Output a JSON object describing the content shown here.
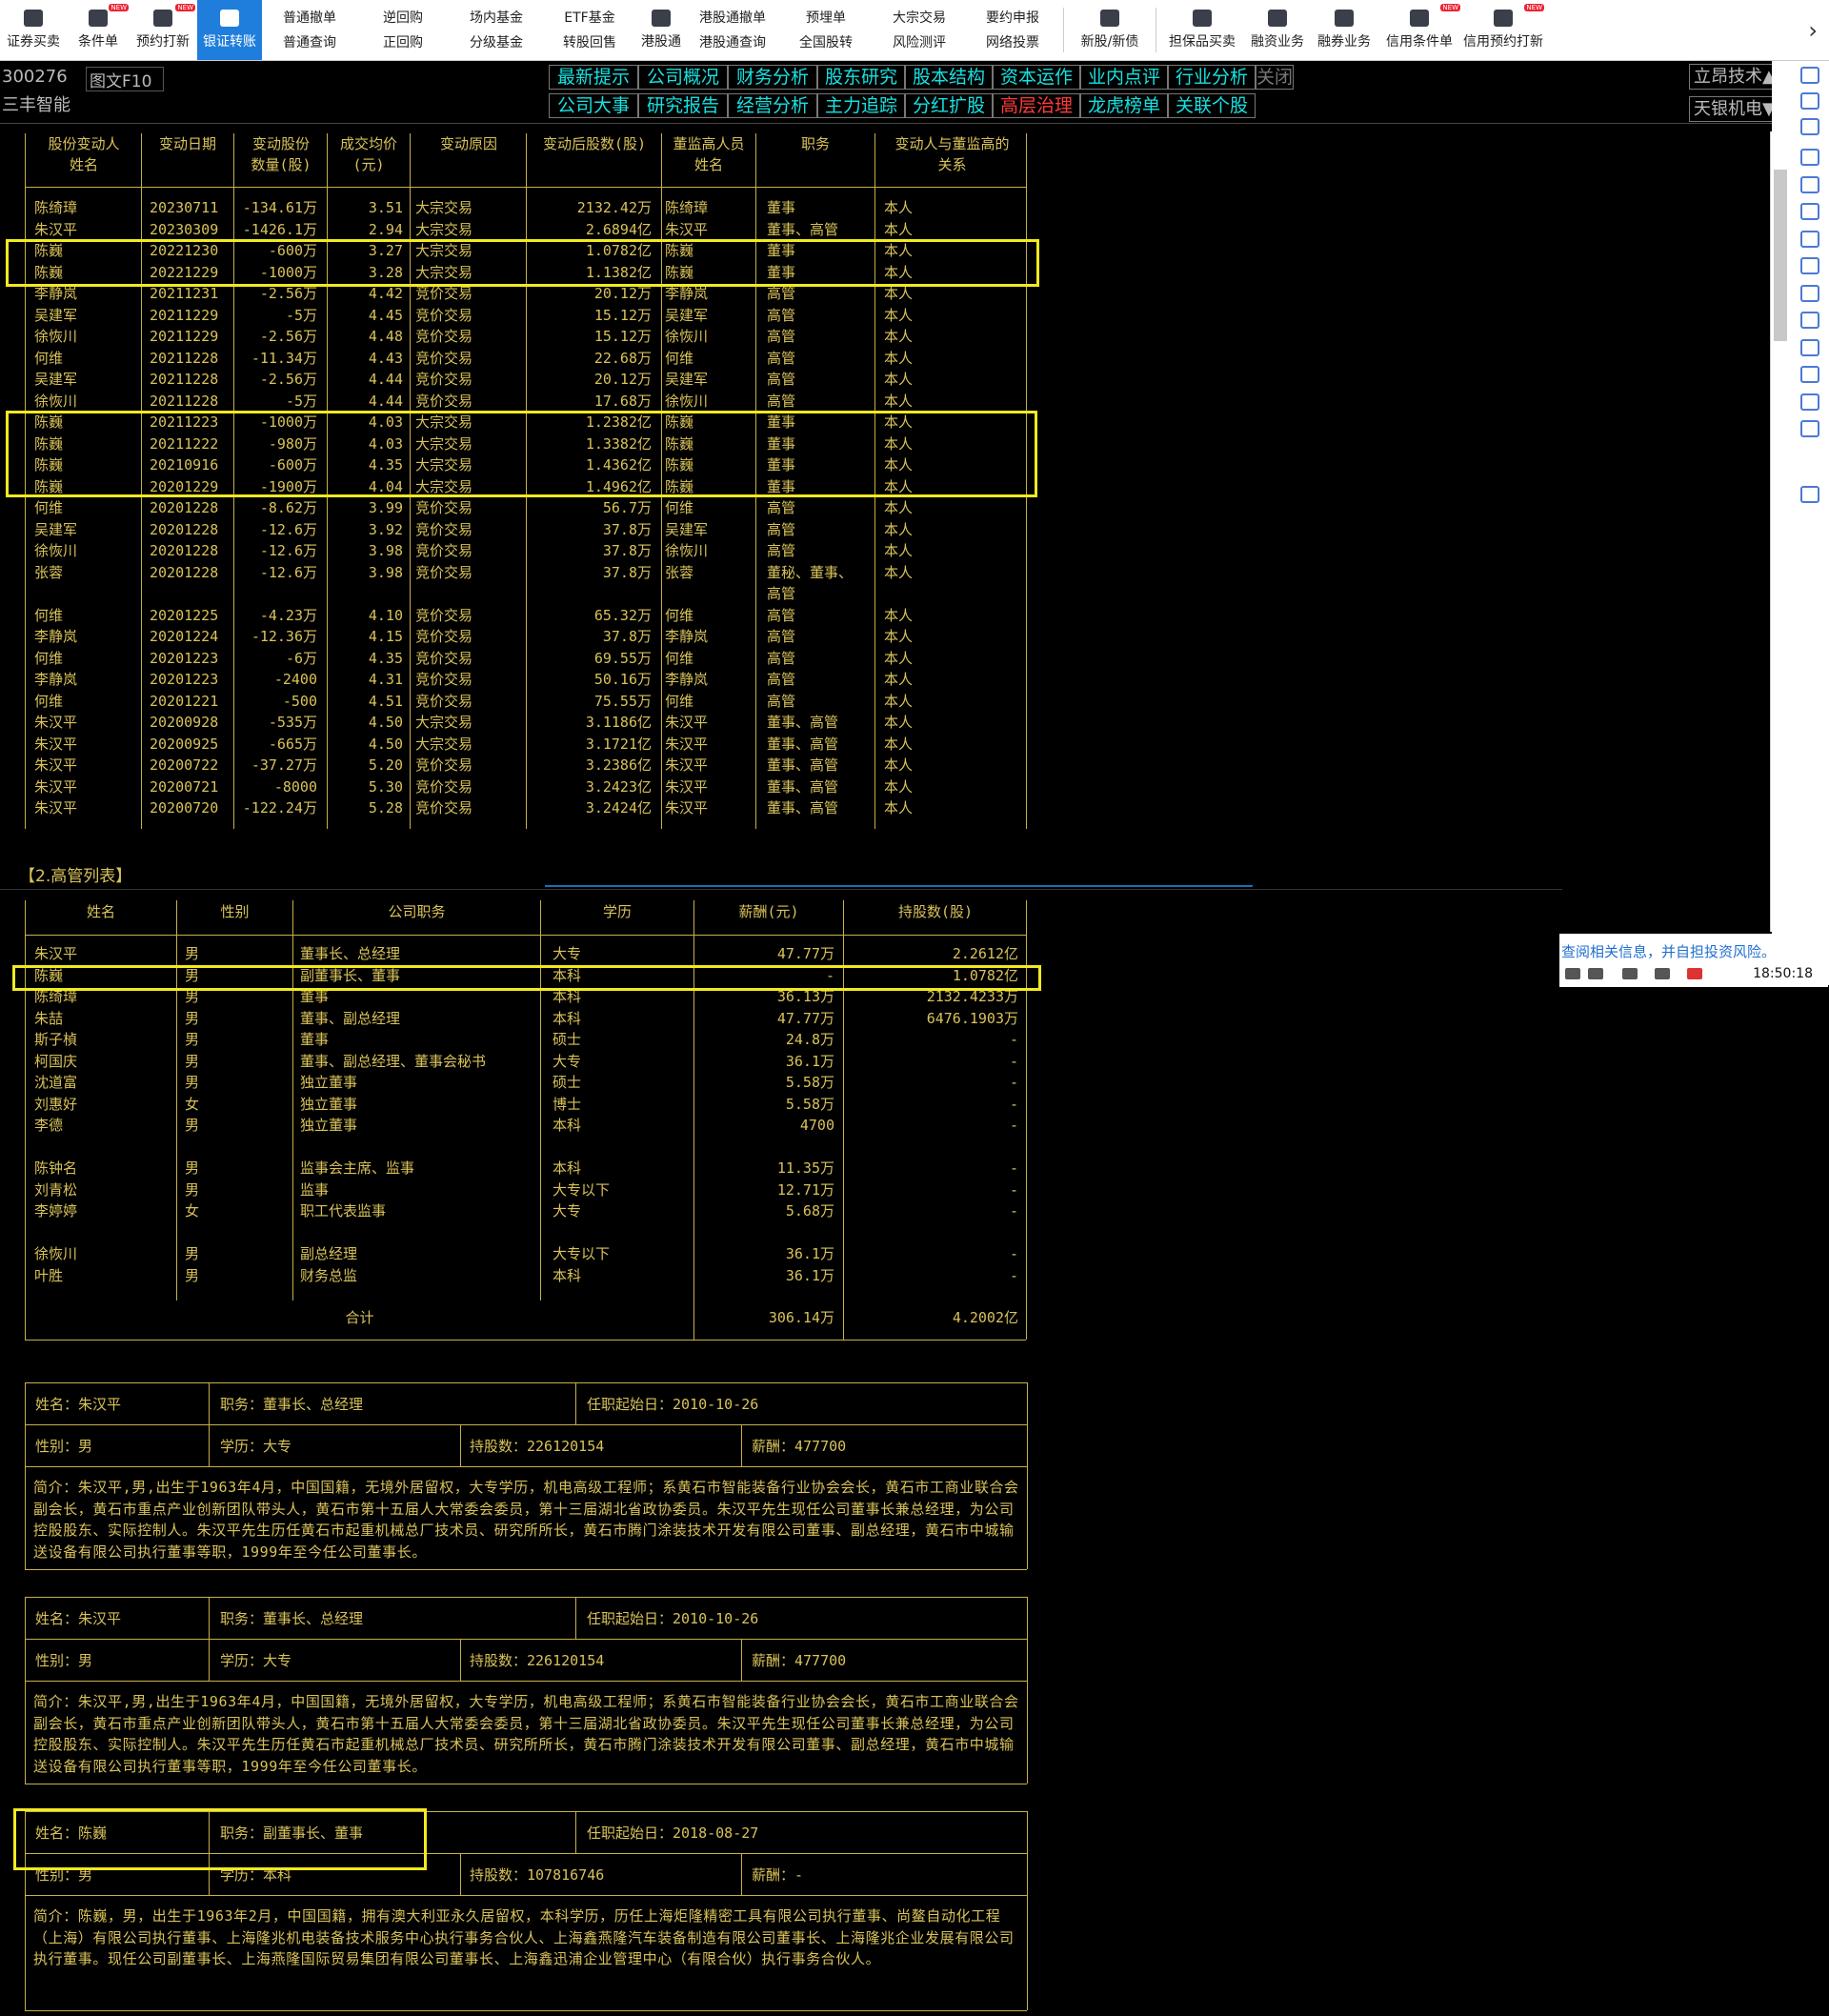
{
  "toolbar": {
    "items": [
      {
        "label": "证券买卖",
        "icon": "chart-icon",
        "new": false
      },
      {
        "label": "条件单",
        "icon": "document-icon",
        "new": true
      },
      {
        "label": "预约打新",
        "icon": "calendar-icon",
        "new": true
      },
      {
        "label": "银证转账",
        "icon": "transfer-icon",
        "new": false,
        "active": true
      }
    ],
    "doubles": [
      {
        "top": "普通撤单",
        "bottom": "普通查询"
      },
      {
        "top": "逆回购",
        "bottom": "正回购"
      },
      {
        "top": "场内基金",
        "bottom": "分级基金"
      },
      {
        "top": "ETF基金",
        "bottom": "转股回售"
      }
    ],
    "hk": {
      "label": "港股通",
      "icon": "hk-icon"
    },
    "doubles2": [
      {
        "top": "港股通撤单",
        "bottom": "港股通查询"
      },
      {
        "top": "预埋单",
        "bottom": "全国股转"
      },
      {
        "top": "大宗交易",
        "bottom": "风险测评"
      },
      {
        "top": "要约申报",
        "bottom": "网络投票"
      }
    ],
    "items2": [
      {
        "label": "新股/新债",
        "icon": "new-stock-icon",
        "new": false
      },
      {
        "label": "担保品买卖",
        "icon": "shield-icon",
        "new": false
      },
      {
        "label": "融资业务",
        "icon": "finance-icon",
        "new": false
      },
      {
        "label": "融券业务",
        "icon": "securities-lending-icon",
        "new": false
      },
      {
        "label": "信用条件单",
        "icon": "credit-condition-icon",
        "new": true
      },
      {
        "label": "信用预约打新",
        "icon": "credit-ipo-icon",
        "new": true
      }
    ],
    "more_arrow": "›"
  },
  "stock": {
    "code": "300276",
    "name": "三丰智能",
    "f10": "图文F10"
  },
  "nav": {
    "row1": [
      "最新提示",
      "公司概况",
      "财务分析",
      "股东研究",
      "股本结构",
      "资本运作",
      "业内点评",
      "行业分析",
      "关闭"
    ],
    "row2": [
      "公司大事",
      "研究报告",
      "经营分析",
      "主力追踪",
      "分红扩股",
      "高层治理",
      "龙虎榜单",
      "关联个股"
    ]
  },
  "right_selects": [
    "立昂技术▲",
    "天银机电▼"
  ],
  "table1": {
    "headers1": [
      "股份变动人",
      "变动日期",
      "变动股份",
      "成交均价",
      "变动原因",
      "变动后股数(股)",
      "董监高人员",
      "职务",
      "变动人与董监高的"
    ],
    "headers2": [
      "姓名",
      "",
      "数量(股)",
      "(元)",
      "",
      "",
      "姓名",
      "",
      "关系"
    ],
    "rows": [
      [
        "陈绮璋",
        "20230711",
        "-134.61万",
        "3.51",
        "大宗交易",
        "2132.42万",
        "陈绮璋",
        "董事",
        "本人"
      ],
      [
        "朱汉平",
        "20230309",
        "-1426.1万",
        "2.94",
        "大宗交易",
        "2.6894亿",
        "朱汉平",
        "董事、高管",
        "本人"
      ],
      [
        "陈巍",
        "20221230",
        "-600万",
        "3.27",
        "大宗交易",
        "1.0782亿",
        "陈巍",
        "董事",
        "本人"
      ],
      [
        "陈巍",
        "20221229",
        "-1000万",
        "3.28",
        "大宗交易",
        "1.1382亿",
        "陈巍",
        "董事",
        "本人"
      ],
      [
        "李静岚",
        "20211231",
        "-2.56万",
        "4.42",
        "竞价交易",
        "20.12万",
        "李静岚",
        "高管",
        "本人"
      ],
      [
        "吴建军",
        "20211229",
        "-5万",
        "4.45",
        "竞价交易",
        "15.12万",
        "吴建军",
        "高管",
        "本人"
      ],
      [
        "徐恢川",
        "20211229",
        "-2.56万",
        "4.48",
        "竞价交易",
        "15.12万",
        "徐恢川",
        "高管",
        "本人"
      ],
      [
        "何维",
        "20211228",
        "-11.34万",
        "4.43",
        "竞价交易",
        "22.68万",
        "何维",
        "高管",
        "本人"
      ],
      [
        "吴建军",
        "20211228",
        "-2.56万",
        "4.44",
        "竞价交易",
        "20.12万",
        "吴建军",
        "高管",
        "本人"
      ],
      [
        "徐恢川",
        "20211228",
        "-5万",
        "4.44",
        "竞价交易",
        "17.68万",
        "徐恢川",
        "高管",
        "本人"
      ],
      [
        "陈巍",
        "20211223",
        "-1000万",
        "4.03",
        "大宗交易",
        "1.2382亿",
        "陈巍",
        "董事",
        "本人"
      ],
      [
        "陈巍",
        "20211222",
        "-980万",
        "4.03",
        "大宗交易",
        "1.3382亿",
        "陈巍",
        "董事",
        "本人"
      ],
      [
        "陈巍",
        "20210916",
        "-600万",
        "4.35",
        "大宗交易",
        "1.4362亿",
        "陈巍",
        "董事",
        "本人"
      ],
      [
        "陈巍",
        "20201229",
        "-1900万",
        "4.04",
        "大宗交易",
        "1.4962亿",
        "陈巍",
        "董事",
        "本人"
      ],
      [
        "何维",
        "20201228",
        "-8.62万",
        "3.99",
        "竞价交易",
        "56.7万",
        "何维",
        "高管",
        "本人"
      ],
      [
        "吴建军",
        "20201228",
        "-12.6万",
        "3.92",
        "竞价交易",
        "37.8万",
        "吴建军",
        "高管",
        "本人"
      ],
      [
        "徐恢川",
        "20201228",
        "-12.6万",
        "3.98",
        "竞价交易",
        "37.8万",
        "徐恢川",
        "高管",
        "本人"
      ],
      [
        "张蓉",
        "20201228",
        "-12.6万",
        "3.98",
        "竞价交易",
        "37.8万",
        "张蓉",
        "董秘、董事、",
        "本人"
      ],
      [
        "",
        "",
        "",
        "",
        "",
        "",
        "",
        "高管",
        ""
      ],
      [
        "何维",
        "20201225",
        "-4.23万",
        "4.10",
        "竞价交易",
        "65.32万",
        "何维",
        "高管",
        "本人"
      ],
      [
        "李静岚",
        "20201224",
        "-12.36万",
        "4.15",
        "竞价交易",
        "37.8万",
        "李静岚",
        "高管",
        "本人"
      ],
      [
        "何维",
        "20201223",
        "-6万",
        "4.35",
        "竞价交易",
        "69.55万",
        "何维",
        "高管",
        "本人"
      ],
      [
        "李静岚",
        "20201223",
        "-2400",
        "4.31",
        "竞价交易",
        "50.16万",
        "李静岚",
        "高管",
        "本人"
      ],
      [
        "何维",
        "20201221",
        "-500",
        "4.51",
        "竞价交易",
        "75.55万",
        "何维",
        "高管",
        "本人"
      ],
      [
        "朱汉平",
        "20200928",
        "-535万",
        "4.50",
        "大宗交易",
        "3.1186亿",
        "朱汉平",
        "董事、高管",
        "本人"
      ],
      [
        "朱汉平",
        "20200925",
        "-665万",
        "4.50",
        "大宗交易",
        "3.1721亿",
        "朱汉平",
        "董事、高管",
        "本人"
      ],
      [
        "朱汉平",
        "20200722",
        "-37.27万",
        "5.20",
        "竞价交易",
        "3.2386亿",
        "朱汉平",
        "董事、高管",
        "本人"
      ],
      [
        "朱汉平",
        "20200721",
        "-8000",
        "5.30",
        "竞价交易",
        "3.2423亿",
        "朱汉平",
        "董事、高管",
        "本人"
      ],
      [
        "朱汉平",
        "20200720",
        "-122.24万",
        "5.28",
        "竞价交易",
        "3.2424亿",
        "朱汉平",
        "董事、高管",
        "本人"
      ]
    ]
  },
  "section2_title": "【2.高管列表】",
  "table2": {
    "headers": [
      "姓名",
      "性别",
      "公司职务",
      "学历",
      "薪酬(元)",
      "持股数(股)"
    ],
    "groups": [
      [
        [
          "朱汉平",
          "男",
          "董事长、总经理",
          "大专",
          "47.77万",
          "2.2612亿"
        ],
        [
          "陈巍",
          "男",
          "副董事长、董事",
          "本科",
          "-",
          "1.0782亿"
        ],
        [
          "陈绮璋",
          "男",
          "董事",
          "本科",
          "36.13万",
          "2132.4233万"
        ],
        [
          "朱喆",
          "男",
          "董事、副总经理",
          "本科",
          "47.77万",
          "6476.1903万"
        ],
        [
          "斯子楨",
          "男",
          "董事",
          "硕士",
          "24.8万",
          "-"
        ],
        [
          "柯国庆",
          "男",
          "董事、副总经理、董事会秘书",
          "大专",
          "36.1万",
          "-"
        ],
        [
          "沈道富",
          "男",
          "独立董事",
          "硕士",
          "5.58万",
          "-"
        ],
        [
          "刘惠好",
          "女",
          "独立董事",
          "博士",
          "5.58万",
          "-"
        ],
        [
          "李德",
          "男",
          "独立董事",
          "本科",
          "4700",
          "-"
        ]
      ],
      [
        [
          "陈钟名",
          "男",
          "监事会主席、监事",
          "本科",
          "11.35万",
          "-"
        ],
        [
          "刘青松",
          "男",
          "监事",
          "大专以下",
          "12.71万",
          "-"
        ],
        [
          "李婷婷",
          "女",
          "职工代表监事",
          "大专",
          "5.68万",
          "-"
        ]
      ],
      [
        [
          "徐恢川",
          "男",
          "副总经理",
          "大专以下",
          "36.1万",
          "-"
        ],
        [
          "叶胜",
          "男",
          "财务总监",
          "本科",
          "36.1万",
          "-"
        ]
      ]
    ],
    "total": {
      "label": "合计",
      "salary": "306.14万",
      "shares": "4.2002亿"
    }
  },
  "profiles": [
    {
      "name": "姓名：朱汉平",
      "position": "职务：董事长、总经理",
      "start": "任职起始日：2010-10-26",
      "gender": "性别：男",
      "edu": "学历：大专",
      "shares": "持股数：226120154",
      "salary": "薪酬：477700",
      "bio": "简介：朱汉平,男,出生于1963年4月，中国国籍，无境外居留权，大专学历，机电高级工程师；系黄石市智能装备行业协会会长，黄石市工商业联合会副会长，黄石市重点产业创新团队带头人，黄石市第十五届人大常委会委员，第十三届湖北省政协委员。朱汉平先生现任公司董事长兼总经理，为公司控股股东、实际控制人。朱汉平先生历任黄石市起重机械总厂技术员、研究所所长，黄石市腾门涂装技术开发有限公司董事、副总经理，黄石市中城输送设备有限公司执行董事等职，1999年至今任公司董事长。"
    },
    {
      "name": "姓名：朱汉平",
      "position": "职务：董事长、总经理",
      "start": "任职起始日：2010-10-26",
      "gender": "性别：男",
      "edu": "学历：大专",
      "shares": "持股数：226120154",
      "salary": "薪酬：477700",
      "bio": "简介：朱汉平,男,出生于1963年4月，中国国籍，无境外居留权，大专学历，机电高级工程师；系黄石市智能装备行业协会会长，黄石市工商业联合会副会长，黄石市重点产业创新团队带头人，黄石市第十五届人大常委会委员，第十三届湖北省政协委员。朱汉平先生现任公司董事长兼总经理，为公司控股股东、实际控制人。朱汉平先生历任黄石市起重机械总厂技术员、研究所所长，黄石市腾门涂装技术开发有限公司董事、副总经理，黄石市中城输送设备有限公司执行董事等职，1999年至今任公司董事长。"
    },
    {
      "name": "姓名：陈巍",
      "position": "职务：副董事长、董事",
      "start": "任职起始日：2018-08-27",
      "gender": "性别：男",
      "edu": "学历：本科",
      "shares": "持股数：107816746",
      "salary": "薪酬：-",
      "bio": "简介：陈巍，男，出生于1963年2月，中国国籍，拥有澳大利亚永久居留权，本科学历，历任上海炬隆精密工具有限公司执行董事、尚鳌自动化工程（上海）有限公司执行董事、上海隆兆机电装备技术服务中心执行事务合伙人、上海鑫燕隆汽车装备制造有限公司董事长、上海隆兆企业发展有限公司执行董事。现任公司副董事长、上海燕隆国际贸易集团有限公司董事长、上海鑫迅浦企业管理中心（有限合伙）执行事务合伙人。"
    }
  ],
  "status": {
    "warning": "查阅相关信息，并自担投资风险。",
    "time": "18:50:18"
  }
}
